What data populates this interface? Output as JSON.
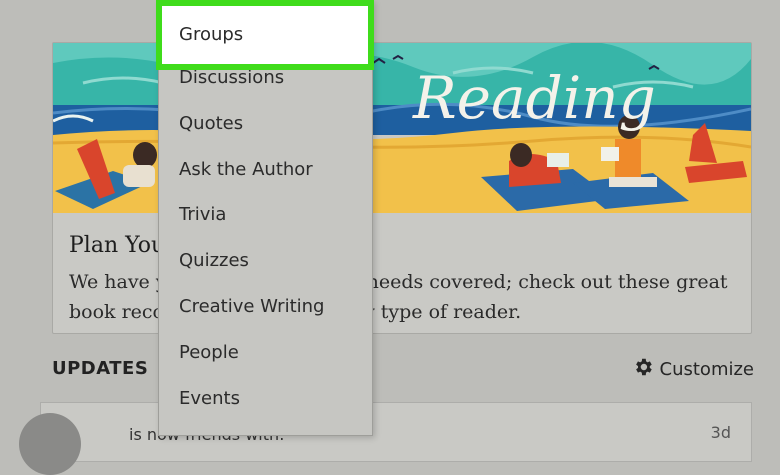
{
  "card": {
    "banner_text": "Reading",
    "title": "Plan You",
    "body_line1_left": "We have y",
    "body_line1_right": "needs covered; check out these great",
    "body_line2_left": "book reco",
    "body_line2_right": "y type of reader."
  },
  "updates": {
    "heading": "UPDATES",
    "customize_label": "Customize",
    "feed_text": "is now friends with:",
    "feed_time": "3d"
  },
  "menu": {
    "highlighted": "Groups",
    "items": [
      "Discussions",
      "Quotes",
      "Ask the Author",
      "Trivia",
      "Quizzes",
      "Creative Writing",
      "People",
      "Events"
    ]
  },
  "colors": {
    "highlight_border": "#3fdc1b",
    "background": "#bdbdb9"
  },
  "icons": {
    "customize": "gear-icon"
  }
}
